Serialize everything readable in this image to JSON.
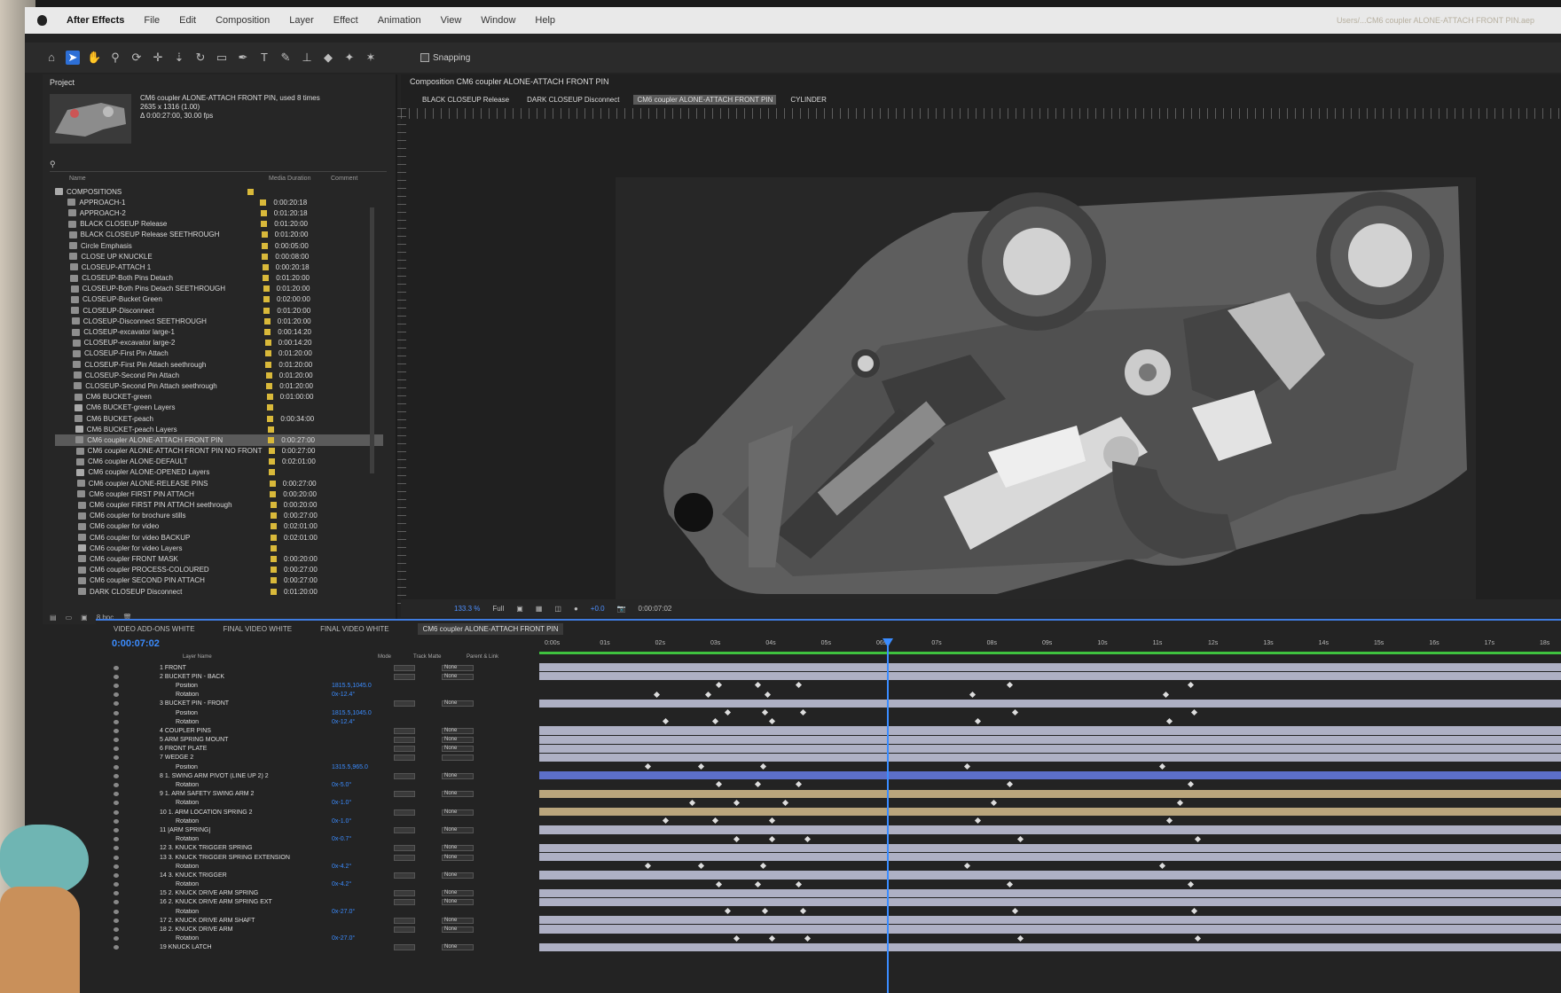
{
  "menubar": {
    "app": "After Effects",
    "items": [
      "File",
      "Edit",
      "Composition",
      "Layer",
      "Effect",
      "Animation",
      "View",
      "Window",
      "Help"
    ],
    "path": "Users/...CM6 coupler ALONE-ATTACH FRONT PIN.aep"
  },
  "toolbar": {
    "snapping_label": "Snapping",
    "icons": [
      "home-icon",
      "selection-icon",
      "hand-icon",
      "zoom-icon",
      "orbit-icon",
      "pan-icon",
      "dolly-icon",
      "rotate-icon",
      "rect-mask-icon",
      "pen-icon",
      "type-icon",
      "brush-icon",
      "clone-icon",
      "eraser-icon",
      "roto-icon",
      "puppet-icon"
    ]
  },
  "project": {
    "tab_label": "Project",
    "comp_name": "CM6 coupler ALONE-ATTACH FRONT PIN",
    "comp_used": ", used 8 times",
    "comp_dims": "2635 x 1316 (1.00)",
    "comp_dur": "Δ 0:00:27:00, 30.00 fps",
    "col_name": "Name",
    "col_duration": "Media Duration",
    "col_comment": "Comment",
    "footer_bpc": "8 bpc",
    "items": [
      {
        "name": "COMPOSITIONS",
        "dur": "",
        "folder": true
      },
      {
        "name": "APPROACH-1",
        "dur": "0:00:20:18"
      },
      {
        "name": "APPROACH-2",
        "dur": "0:01:20:18"
      },
      {
        "name": "BLACK CLOSEUP Release",
        "dur": "0:01:20:00"
      },
      {
        "name": "BLACK CLOSEUP Release SEETHROUGH",
        "dur": "0:01:20:00"
      },
      {
        "name": "Circle Emphasis",
        "dur": "0:00:05:00"
      },
      {
        "name": "CLOSE UP KNUCKLE",
        "dur": "0:00:08:00"
      },
      {
        "name": "CLOSEUP-ATTACH 1",
        "dur": "0:00:20:18"
      },
      {
        "name": "CLOSEUP-Both Pins Detach",
        "dur": "0:01:20:00"
      },
      {
        "name": "CLOSEUP-Both Pins Detach SEETHROUGH",
        "dur": "0:01:20:00"
      },
      {
        "name": "CLOSEUP-Bucket Green",
        "dur": "0:02:00:00"
      },
      {
        "name": "CLOSEUP-Disconnect",
        "dur": "0:01:20:00"
      },
      {
        "name": "CLOSEUP-Disconnect SEETHROUGH",
        "dur": "0:01:20:00"
      },
      {
        "name": "CLOSEUP-excavator large-1",
        "dur": "0:00:14:20"
      },
      {
        "name": "CLOSEUP-excavator large-2",
        "dur": "0:00:14:20"
      },
      {
        "name": "CLOSEUP-First Pin Attach",
        "dur": "0:01:20:00"
      },
      {
        "name": "CLOSEUP-First Pin Attach seethrough",
        "dur": "0:01:20:00"
      },
      {
        "name": "CLOSEUP-Second Pin Attach",
        "dur": "0:01:20:00"
      },
      {
        "name": "CLOSEUP-Second Pin Attach seethrough",
        "dur": "0:01:20:00"
      },
      {
        "name": "CM6 BUCKET-green",
        "dur": "0:01:00:00"
      },
      {
        "name": "CM6 BUCKET-green Layers",
        "dur": "",
        "folder": true
      },
      {
        "name": "CM6 BUCKET-peach",
        "dur": "0:00:34:00"
      },
      {
        "name": "CM6 BUCKET-peach Layers",
        "dur": "",
        "folder": true
      },
      {
        "name": "CM6 coupler ALONE-ATTACH FRONT PIN",
        "dur": "0:00:27:00",
        "selected": true
      },
      {
        "name": "CM6 coupler ALONE-ATTACH FRONT PIN NO FRONT",
        "dur": "0:00:27:00"
      },
      {
        "name": "CM6 coupler ALONE-DEFAULT",
        "dur": "0:02:01:00"
      },
      {
        "name": "CM6 coupler ALONE-OPENED Layers",
        "dur": "",
        "folder": true
      },
      {
        "name": "CM6 coupler ALONE-RELEASE PINS",
        "dur": "0:00:27:00"
      },
      {
        "name": "CM6 coupler FIRST PIN ATTACH",
        "dur": "0:00:20:00"
      },
      {
        "name": "CM6 coupler FIRST PIN ATTACH seethrough",
        "dur": "0:00:20:00"
      },
      {
        "name": "CM6 coupler for brochure stills",
        "dur": "0:00:27:00"
      },
      {
        "name": "CM6 coupler for video",
        "dur": "0:02:01:00"
      },
      {
        "name": "CM6 coupler for video BACKUP",
        "dur": "0:02:01:00"
      },
      {
        "name": "CM6 coupler for video Layers",
        "dur": "",
        "folder": true
      },
      {
        "name": "CM6 coupler FRONT MASK",
        "dur": "0:00:20:00"
      },
      {
        "name": "CM6 coupler PROCESS-COLOURED",
        "dur": "0:00:27:00"
      },
      {
        "name": "CM6 coupler SECOND PIN ATTACH",
        "dur": "0:00:27:00"
      },
      {
        "name": "DARK CLOSEUP Disconnect",
        "dur": "0:01:20:00"
      }
    ]
  },
  "comp": {
    "title": "Composition CM6 coupler ALONE-ATTACH FRONT PIN",
    "crumbs": [
      "BLACK CLOSEUP Release",
      "DARK CLOSEUP Disconnect",
      "CM6 coupler ALONE-ATTACH FRONT PIN",
      "CYLINDER"
    ],
    "zoom": "133.3 %",
    "resolution": "Full",
    "timecode": "0:00:07:02",
    "exposure": "+0.0"
  },
  "timeline": {
    "tabs": [
      "VIDEO ADD-ONS WHITE",
      "FINAL VIDEO WHITE",
      "FINAL VIDEO WHITE",
      "CM6 coupler ALONE-ATTACH FRONT PIN"
    ],
    "timecode": "0:00:07:02",
    "col_layer": "Layer Name",
    "col_mode": "Mode",
    "col_trkmat": "Track Matte",
    "col_parent": "Parent & Link",
    "ticks": [
      "0:00s",
      "01s",
      "02s",
      "03s",
      "04s",
      "05s",
      "06s",
      "07s",
      "08s",
      "09s",
      "10s",
      "11s",
      "12s",
      "13s",
      "14s",
      "15s",
      "16s",
      "17s",
      "18s"
    ],
    "layers": [
      {
        "name": "1  FRONT",
        "val": "",
        "parent": "None"
      },
      {
        "name": "2  BUCKET PIN - BACK",
        "val": "",
        "parent": "None"
      },
      {
        "name": "Position",
        "val": "1815.5,1045.0",
        "parent": ""
      },
      {
        "name": "Rotation",
        "val": "0x-12.4°",
        "parent": ""
      },
      {
        "name": "3  BUCKET PIN - FRONT",
        "val": "",
        "parent": "None"
      },
      {
        "name": "Position",
        "val": "1815.5,1045.0",
        "parent": ""
      },
      {
        "name": "Rotation",
        "val": "0x-12.4°",
        "parent": ""
      },
      {
        "name": "4  COUPLER PINS",
        "val": "",
        "parent": "None"
      },
      {
        "name": "5  ARM SPRING MOUNT",
        "val": "",
        "parent": "None"
      },
      {
        "name": "6  FRONT PLATE",
        "val": "",
        "parent": "None"
      },
      {
        "name": "7  WEDGE 2",
        "val": "",
        "parent": ""
      },
      {
        "name": "Position",
        "val": "1315.5,965.0",
        "parent": ""
      },
      {
        "name": "8  1. SWING ARM PIVOT (LINE UP 2) 2",
        "val": "",
        "parent": "None"
      },
      {
        "name": "Rotation",
        "val": "0x-5.0°",
        "parent": ""
      },
      {
        "name": "9  1. ARM SAFETY SWING ARM 2",
        "val": "",
        "parent": "None"
      },
      {
        "name": "Rotation",
        "val": "0x-1.0°",
        "parent": ""
      },
      {
        "name": "10  1. ARM LOCATION SPRING 2",
        "val": "",
        "parent": "None"
      },
      {
        "name": "Rotation",
        "val": "0x-1.0°",
        "parent": ""
      },
      {
        "name": "11  [ARM SPRING]",
        "val": "",
        "parent": "None"
      },
      {
        "name": "Rotation",
        "val": "0x-0.7°",
        "parent": ""
      },
      {
        "name": "12  3. KNUCK TRIGGER SPRING",
        "val": "",
        "parent": "None"
      },
      {
        "name": "13  3. KNUCK TRIGGER SPRING EXTENSION",
        "val": "",
        "parent": "None"
      },
      {
        "name": "Rotation",
        "val": "0x-4.2°",
        "parent": ""
      },
      {
        "name": "14  3. KNUCK TRIGGER",
        "val": "",
        "parent": "None"
      },
      {
        "name": "Rotation",
        "val": "0x-4.2°",
        "parent": ""
      },
      {
        "name": "15  2. KNUCK DRIVE ARM SPRING",
        "val": "",
        "parent": "None"
      },
      {
        "name": "16  2. KNUCK DRIVE ARM SPRING EXT",
        "val": "",
        "parent": "None"
      },
      {
        "name": "Rotation",
        "val": "0x-27.0°",
        "parent": ""
      },
      {
        "name": "17  2. KNUCK DRIVE ARM SHAFT",
        "val": "",
        "parent": "None"
      },
      {
        "name": "18  2. KNUCK DRIVE ARM",
        "val": "",
        "parent": "None"
      },
      {
        "name": "Rotation",
        "val": "0x-27.0°",
        "parent": ""
      },
      {
        "name": "19  KNUCK LATCH",
        "val": "",
        "parent": "None"
      }
    ]
  },
  "colors": {
    "accent": "#3b8cff",
    "label_yellow": "#d9b93a",
    "work_area": "#3fc23f",
    "track_default": "#aeb0c4",
    "track_blue": "#5c6fc9",
    "track_tan": "#b9a57c"
  }
}
